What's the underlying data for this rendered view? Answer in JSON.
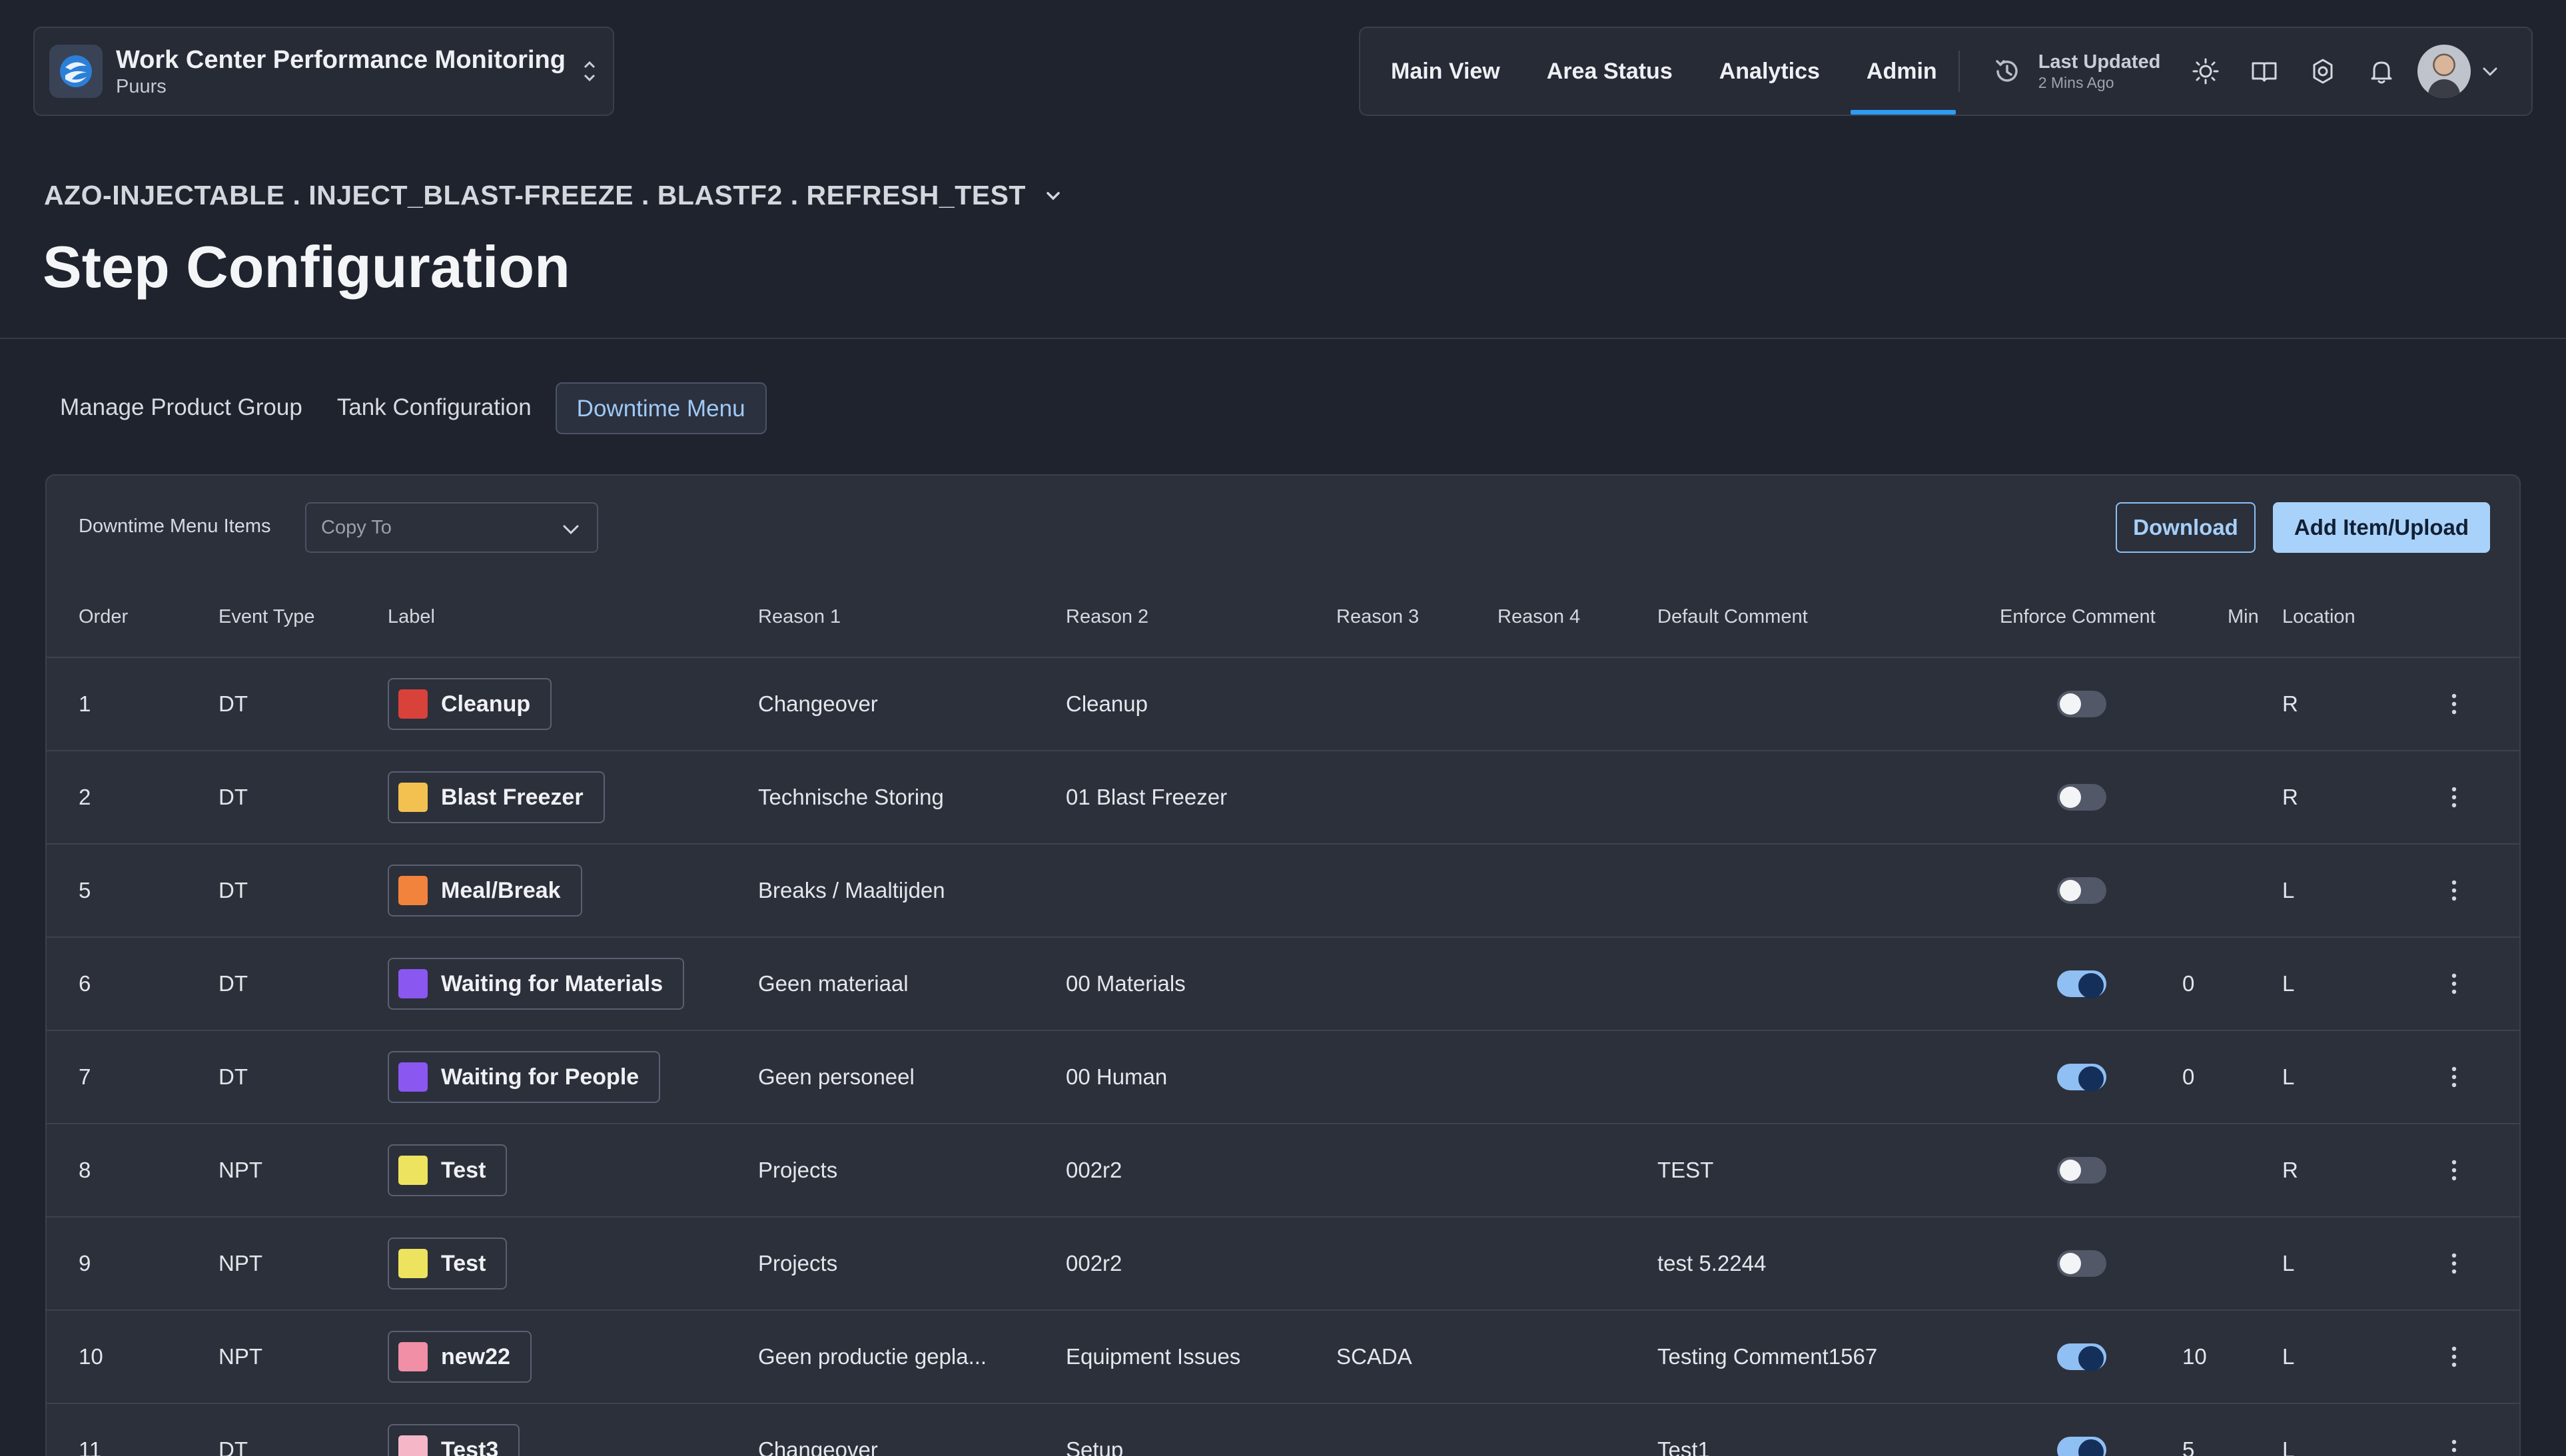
{
  "app": {
    "title": "Work Center Performance Monitoring",
    "subtitle": "Puurs"
  },
  "nav": {
    "items": [
      {
        "label": "Main View"
      },
      {
        "label": "Area Status"
      },
      {
        "label": "Analytics"
      },
      {
        "label": "Admin",
        "active": true
      }
    ],
    "last_updated_label": "Last Updated",
    "last_updated_value": "2 Mins Ago"
  },
  "breadcrumb": "AZO-INJECTABLE . INJECT_BLAST-FREEZE . BLASTF2 . REFRESH_TEST",
  "page_title": "Step Configuration",
  "tabs": [
    {
      "label": "Manage Product Group"
    },
    {
      "label": "Tank Configuration"
    },
    {
      "label": "Downtime Menu",
      "active": true
    }
  ],
  "toolbar": {
    "section_label": "Downtime Menu Items",
    "copy_to_placeholder": "Copy To",
    "download_label": "Download",
    "add_label": "Add Item/Upload"
  },
  "table": {
    "headers": {
      "order": "Order",
      "event_type": "Event Type",
      "label": "Label",
      "reason1": "Reason 1",
      "reason2": "Reason 2",
      "reason3": "Reason 3",
      "reason4": "Reason 4",
      "default_comment": "Default Comment",
      "enforce_comment": "Enforce Comment",
      "min": "Min",
      "location": "Location"
    },
    "rows": [
      {
        "order": "1",
        "event_type": "DT",
        "label": "Cleanup",
        "color": "#d9413b",
        "reason1": "Changeover",
        "reason2": "Cleanup",
        "reason3": "",
        "reason4": "",
        "default_comment": "",
        "enforce": false,
        "min": "",
        "location": "R"
      },
      {
        "order": "2",
        "event_type": "DT",
        "label": "Blast Freezer",
        "color": "#f2c150",
        "reason1": "Technische Storing",
        "reason2": "01 Blast Freezer",
        "reason3": "",
        "reason4": "",
        "default_comment": "",
        "enforce": false,
        "min": "",
        "location": "R"
      },
      {
        "order": "5",
        "event_type": "DT",
        "label": "Meal/Break",
        "color": "#f2833c",
        "reason1": "Breaks / Maaltijden",
        "reason2": "",
        "reason3": "",
        "reason4": "",
        "default_comment": "",
        "enforce": false,
        "min": "",
        "location": "L"
      },
      {
        "order": "6",
        "event_type": "DT",
        "label": "Waiting for Materials",
        "color": "#8a57f0",
        "reason1": "Geen materiaal",
        "reason2": "00 Materials",
        "reason3": "",
        "reason4": "",
        "default_comment": "",
        "enforce": true,
        "min": "0",
        "location": "L"
      },
      {
        "order": "7",
        "event_type": "DT",
        "label": "Waiting for People",
        "color": "#8a57f0",
        "reason1": "Geen personeel",
        "reason2": "00 Human",
        "reason3": "",
        "reason4": "",
        "default_comment": "",
        "enforce": true,
        "min": "0",
        "location": "L"
      },
      {
        "order": "8",
        "event_type": "NPT",
        "label": "Test",
        "color": "#ede35e",
        "reason1": "Projects",
        "reason2": "002r2",
        "reason3": "",
        "reason4": "",
        "default_comment": "TEST",
        "enforce": false,
        "min": "",
        "location": "R"
      },
      {
        "order": "9",
        "event_type": "NPT",
        "label": "Test",
        "color": "#ede35e",
        "reason1": "Projects",
        "reason2": "002r2",
        "reason3": "",
        "reason4": "",
        "default_comment": "test 5.2244",
        "enforce": false,
        "min": "",
        "location": "L"
      },
      {
        "order": "10",
        "event_type": "NPT",
        "label": "new22",
        "color": "#f08fa5",
        "reason1": "Geen productie gepla...",
        "reason2": "Equipment Issues",
        "reason3": "SCADA",
        "reason4": "",
        "default_comment": "Testing Comment1567",
        "enforce": true,
        "min": "10",
        "location": "L"
      },
      {
        "order": "11",
        "event_type": "DT",
        "label": "Test3",
        "color": "#f5b7c8",
        "reason1": "Changeover",
        "reason2": "Setup",
        "reason3": "",
        "reason4": "",
        "default_comment": "Test1",
        "enforce": true,
        "min": "5",
        "location": "L"
      }
    ]
  },
  "icons": {
    "app_logo": "app-logo-icon",
    "switcher": "chevron-up-down-icon",
    "history": "history-icon",
    "theme": "sun-icon",
    "docs": "book-icon",
    "settings": "gear-icon",
    "notifications": "bell-icon",
    "account_menu": "chevron-down-icon",
    "row_menu": "kebab-menu-icon"
  },
  "colors": {
    "accent": "#2f9bf3",
    "primary_button": "#a9d2fb",
    "background": "#1f232d",
    "panel": "#2b303b"
  }
}
